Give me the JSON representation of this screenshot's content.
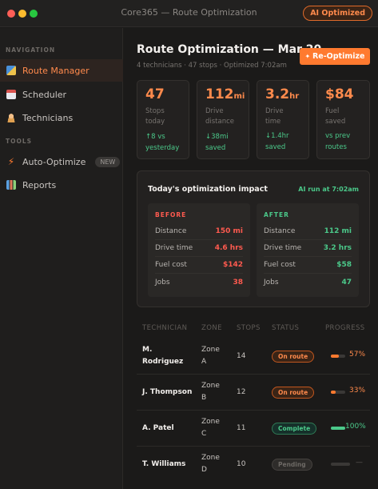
{
  "window": {
    "title": "Core365 — Route Optimization",
    "ai_badge": "AI Optimized"
  },
  "sidebar": {
    "sections": [
      {
        "label": "NAVIGATION",
        "items": [
          {
            "label": "Route Manager",
            "icon": "map-icon",
            "active": true
          },
          {
            "label": "Scheduler",
            "icon": "calendar-icon"
          },
          {
            "label": "Technicians",
            "icon": "person-icon"
          }
        ]
      },
      {
        "label": "TOOLS",
        "items": [
          {
            "label": "Auto-Optimize",
            "icon": "lightning-icon",
            "badge": "NEW"
          },
          {
            "label": "Reports",
            "icon": "bar-chart-icon"
          }
        ]
      }
    ]
  },
  "header": {
    "title": "Route Optimization — Mar 20",
    "subtitle": "4 technicians · 47 stops · Optimized 7:02am",
    "reoptimize_label": "Re-Optimize"
  },
  "stats": [
    {
      "value": "47",
      "unit": "",
      "label_line1": "Stops",
      "label_line2": "today",
      "delta_line1": "↑8 vs",
      "delta_line2": "yesterday"
    },
    {
      "value": "112",
      "unit": "mi",
      "label_line1": "Drive",
      "label_line2": "distance",
      "delta_line1": "↓38mi",
      "delta_line2": "saved"
    },
    {
      "value": "3.2",
      "unit": "hr",
      "label_line1": "Drive time",
      "label_line2": "",
      "delta_line1": "↓1.4hr",
      "delta_line2": "saved"
    },
    {
      "value": "$84",
      "unit": "",
      "label_line1": "Fuel saved",
      "label_line2": "",
      "delta_line1": "vs prev",
      "delta_line2": "routes"
    }
  ],
  "impact": {
    "title": "Today's optimization impact",
    "note": "AI run at 7:02am",
    "before": {
      "heading": "BEFORE",
      "rows": [
        {
          "label": "Distance",
          "value": "150 mi"
        },
        {
          "label": "Drive time",
          "value": "4.6 hrs"
        },
        {
          "label": "Fuel cost",
          "value": "$142"
        },
        {
          "label": "Jobs",
          "value": "38"
        }
      ]
    },
    "after": {
      "heading": "AFTER",
      "rows": [
        {
          "label": "Distance",
          "value": "112 mi"
        },
        {
          "label": "Drive time",
          "value": "3.2 hrs"
        },
        {
          "label": "Fuel cost",
          "value": "$58"
        },
        {
          "label": "Jobs",
          "value": "47"
        }
      ]
    }
  },
  "table": {
    "columns": [
      "TECHNICIAN",
      "ZONE",
      "STOPS",
      "STATUS",
      "PROGRESS"
    ],
    "rows": [
      {
        "name_line1": "M.",
        "name_line2": "Rodriguez",
        "zone_line1": "Zone",
        "zone_line2": "A",
        "stops": "14",
        "status": "On route",
        "status_type": "route",
        "progress": 0.57,
        "progress_label": "57%"
      },
      {
        "name_line1": "J. Thompson",
        "name_line2": "",
        "zone_line1": "Zone",
        "zone_line2": "B",
        "stops": "12",
        "status": "On route",
        "status_type": "route",
        "progress": 0.33,
        "progress_label": "33%"
      },
      {
        "name_line1": "A. Patel",
        "name_line2": "",
        "zone_line1": "Zone",
        "zone_line2": "C",
        "stops": "11",
        "status": "Complete",
        "status_type": "done",
        "progress": 1.0,
        "progress_label": "100%"
      },
      {
        "name_line1": "T. Williams",
        "name_line2": "",
        "zone_line1": "Zone",
        "zone_line2": "D",
        "stops": "10",
        "status": "Pending",
        "status_type": "pending",
        "progress": 0,
        "progress_label": "—"
      }
    ]
  },
  "colors": {
    "accent": "#ff7a2f",
    "positive": "#4bc98a",
    "negative": "#ff5a4f"
  }
}
